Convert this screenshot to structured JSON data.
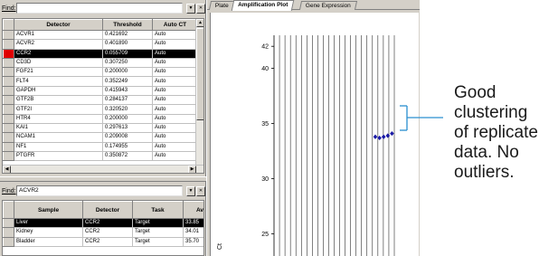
{
  "detector_panel": {
    "find_label": "Find:",
    "find_value": "",
    "columns": [
      "Detector",
      "Threshold",
      "Auto CT"
    ],
    "rows": [
      {
        "detector": "ACVR1",
        "threshold": "0.421692",
        "auto_ct": "Auto"
      },
      {
        "detector": "ACVR2",
        "threshold": "0.401890",
        "auto_ct": "Auto"
      },
      {
        "detector": "CCR2",
        "threshold": "0.055709",
        "auto_ct": "Auto",
        "selected": true
      },
      {
        "detector": "CD3D",
        "threshold": "0.307250",
        "auto_ct": "Auto"
      },
      {
        "detector": "FGF21",
        "threshold": "0.200000",
        "auto_ct": "Auto"
      },
      {
        "detector": "FLT4",
        "threshold": "0.352249",
        "auto_ct": "Auto"
      },
      {
        "detector": "GAPDH",
        "threshold": "0.415943",
        "auto_ct": "Auto"
      },
      {
        "detector": "GTF2B",
        "threshold": "0.284137",
        "auto_ct": "Auto"
      },
      {
        "detector": "GTF2I",
        "threshold": "0.320520",
        "auto_ct": "Auto"
      },
      {
        "detector": "HTR4",
        "threshold": "0.200000",
        "auto_ct": "Auto"
      },
      {
        "detector": "KAI1",
        "threshold": "0.297613",
        "auto_ct": "Auto"
      },
      {
        "detector": "NCAM1",
        "threshold": "0.209008",
        "auto_ct": "Auto"
      },
      {
        "detector": "NF1",
        "threshold": "0.174955",
        "auto_ct": "Auto"
      },
      {
        "detector": "PTGFR",
        "threshold": "0.350872",
        "auto_ct": "Auto"
      }
    ]
  },
  "sample_panel": {
    "find_label": "Find:",
    "find_value": "ACVR2",
    "columns": [
      "Sample",
      "Detector",
      "Task",
      "Avg"
    ],
    "rows": [
      {
        "sample": "Liver",
        "detector": "CCR2",
        "task": "Target",
        "avg": "33.85",
        "selected": true
      },
      {
        "sample": "Kidney",
        "detector": "CCR2",
        "task": "Target",
        "avg": "34.01"
      },
      {
        "sample": "Bladder",
        "detector": "CCR2",
        "task": "Target",
        "avg": "35.70"
      }
    ]
  },
  "tabs": [
    {
      "label": "Plate",
      "active": false
    },
    {
      "label": "Amplification Plot",
      "active": true
    },
    {
      "label": "Gene Expression",
      "active": false
    }
  ],
  "chart_data": {
    "type": "scatter",
    "ylabel": "Ct",
    "y_ticks": [
      25,
      30,
      35,
      40
    ],
    "top_tick": "42",
    "ylim": [
      23,
      43
    ],
    "points": [
      {
        "x": 1,
        "y": 33.8
      },
      {
        "x": 2,
        "y": 33.7
      },
      {
        "x": 3,
        "y": 33.8
      },
      {
        "x": 4,
        "y": 33.9
      },
      {
        "x": 5,
        "y": 34.1
      }
    ],
    "point_color": "#1a1aa6",
    "grid": true,
    "bracket_color": "#2a8fd0"
  },
  "annotation": {
    "lines": [
      "Good",
      "clustering",
      "of replicate",
      "data. No",
      "outliers."
    ]
  }
}
